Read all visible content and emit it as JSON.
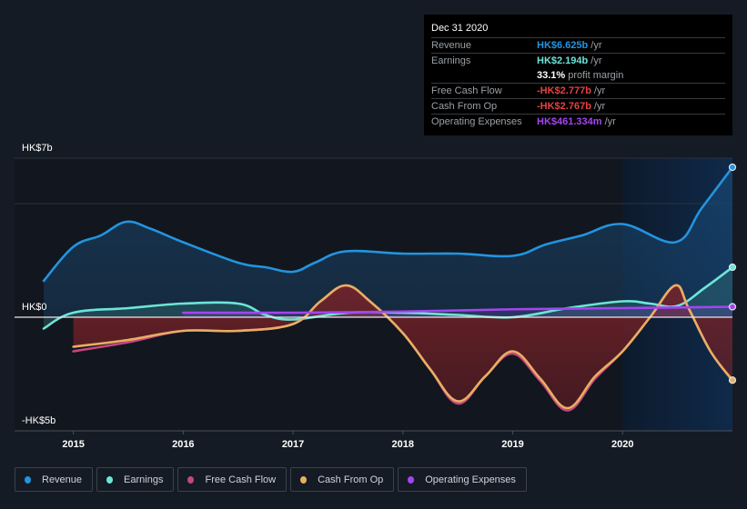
{
  "tooltip": {
    "date": "Dec 31 2020",
    "rows": [
      {
        "label": "Revenue",
        "value": "HK$6.625b",
        "unit": "/yr",
        "color": "#2394df"
      },
      {
        "label": "Earnings",
        "value": "HK$2.194b",
        "unit": "/yr",
        "color": "#6ce5d7"
      },
      {
        "label": "",
        "value": "33.1%",
        "unit": "profit margin",
        "color": "#ffffff"
      },
      {
        "label": "Free Cash Flow",
        "value": "-HK$2.777b",
        "unit": "/yr",
        "color": "#e64141"
      },
      {
        "label": "Cash From Op",
        "value": "-HK$2.767b",
        "unit": "/yr",
        "color": "#e64141"
      },
      {
        "label": "Operating Expenses",
        "value": "HK$461.334m",
        "unit": "/yr",
        "color": "#a445f0"
      }
    ]
  },
  "legend": [
    {
      "label": "Revenue",
      "color": "#2394df"
    },
    {
      "label": "Earnings",
      "color": "#6ce5d7"
    },
    {
      "label": "Free Cash Flow",
      "color": "#c4467f"
    },
    {
      "label": "Cash From Op",
      "color": "#e8ae62"
    },
    {
      "label": "Operating Expenses",
      "color": "#a445f0"
    }
  ],
  "chart_data": {
    "type": "line",
    "title": "",
    "xlabel": "",
    "ylabel": "",
    "unit": "HK$ billions",
    "ylim": [
      -5,
      7
    ],
    "xlim": [
      2014.73,
      2021.0
    ],
    "highlight_from": 2020.0,
    "y_tick_labels": [
      {
        "value": 7,
        "label": "HK$7b"
      },
      {
        "value": 0,
        "label": "HK$0"
      },
      {
        "value": -5,
        "label": "-HK$5b"
      }
    ],
    "x_tick_labels": [
      {
        "value": 2015,
        "label": "2015"
      },
      {
        "value": 2016,
        "label": "2016"
      },
      {
        "value": 2017,
        "label": "2017"
      },
      {
        "value": 2018,
        "label": "2018"
      },
      {
        "value": 2019,
        "label": "2019"
      },
      {
        "value": 2020,
        "label": "2020"
      }
    ],
    "grid_values": [
      7,
      5,
      0
    ],
    "series": [
      {
        "name": "Revenue",
        "color": "#2394df",
        "x": [
          2014.73,
          2015.0,
          2015.25,
          2015.48,
          2015.7,
          2016.0,
          2016.5,
          2016.75,
          2017.0,
          2017.2,
          2017.48,
          2018.0,
          2018.5,
          2019.0,
          2019.3,
          2019.63,
          2020.0,
          2020.48,
          2020.72,
          2021.0
        ],
        "values": [
          1.6,
          3.1,
          3.6,
          4.2,
          3.9,
          3.3,
          2.4,
          2.2,
          2.0,
          2.4,
          2.9,
          2.8,
          2.8,
          2.7,
          3.2,
          3.6,
          4.1,
          3.3,
          4.8,
          6.6
        ]
      },
      {
        "name": "Earnings",
        "color": "#6ce5d7",
        "x": [
          2014.73,
          2015.0,
          2015.5,
          2016.0,
          2016.5,
          2016.75,
          2017.0,
          2017.5,
          2018.0,
          2018.5,
          2019.0,
          2019.5,
          2020.0,
          2020.25,
          2020.5,
          2020.75,
          2021.0
        ],
        "values": [
          -0.5,
          0.2,
          0.4,
          0.6,
          0.6,
          0.1,
          -0.1,
          0.2,
          0.2,
          0.1,
          0.0,
          0.4,
          0.7,
          0.6,
          0.5,
          1.3,
          2.2
        ]
      },
      {
        "name": "Free Cash Flow",
        "color": "#c4467f",
        "x": [
          2015.0,
          2015.5,
          2016.0,
          2016.5,
          2017.0,
          2017.25,
          2017.48,
          2017.7,
          2018.0,
          2018.25,
          2018.5,
          2018.75,
          2019.0,
          2019.25,
          2019.5,
          2019.75,
          2020.0,
          2020.25,
          2020.48,
          2020.6,
          2020.8,
          2021.0
        ],
        "values": [
          -1.5,
          -1.1,
          -0.6,
          -0.6,
          -0.3,
          0.7,
          1.4,
          0.7,
          -0.7,
          -2.3,
          -3.8,
          -2.6,
          -1.6,
          -2.8,
          -4.1,
          -2.7,
          -1.5,
          0.0,
          1.4,
          0.4,
          -1.5,
          -2.8
        ]
      },
      {
        "name": "Cash From Op",
        "color": "#e8ae62",
        "x": [
          2015.0,
          2015.5,
          2016.0,
          2016.5,
          2017.0,
          2017.25,
          2017.48,
          2017.7,
          2018.0,
          2018.25,
          2018.5,
          2018.75,
          2019.0,
          2019.25,
          2019.5,
          2019.75,
          2020.0,
          2020.25,
          2020.48,
          2020.6,
          2020.8,
          2021.0
        ],
        "values": [
          -1.3,
          -1.0,
          -0.6,
          -0.6,
          -0.3,
          0.7,
          1.4,
          0.7,
          -0.7,
          -2.3,
          -3.7,
          -2.6,
          -1.5,
          -2.7,
          -4.0,
          -2.6,
          -1.5,
          0.0,
          1.4,
          0.4,
          -1.5,
          -2.77
        ]
      },
      {
        "name": "Operating Expenses",
        "color": "#a445f0",
        "x": [
          2016.0,
          2017.0,
          2018.0,
          2019.0,
          2020.0,
          2021.0
        ],
        "values": [
          0.2,
          0.2,
          0.25,
          0.35,
          0.4,
          0.46
        ]
      }
    ]
  }
}
